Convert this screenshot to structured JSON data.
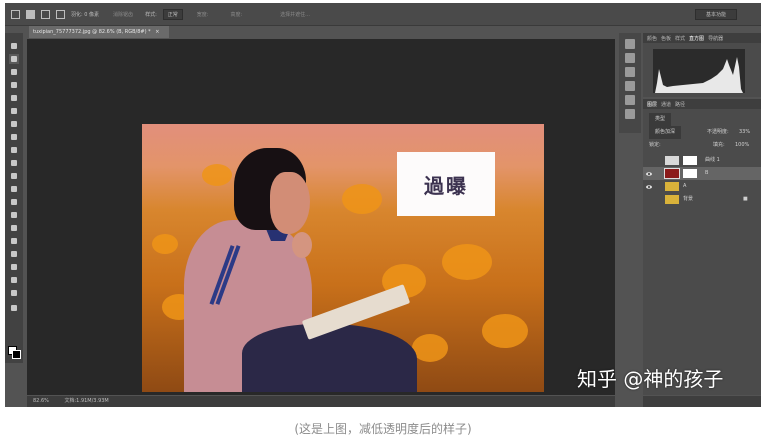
{
  "options_bar": {
    "feather_label": "羽化: 0 像素",
    "antialias_label": "消除锯齿",
    "style_label": "样式:",
    "style_value": "正常",
    "width_label": "宽度:",
    "height_label": "高度:",
    "refine_button": "选择并遮住...",
    "workspace_select": "基本功能"
  },
  "document": {
    "tab_label": "tuxipian_75777372.jpg @ 82.6% (B, RGB/8#) *",
    "tab_close": "×",
    "status_zoom": "82.6%",
    "status_doc": "文档:1.91M/3.93M"
  },
  "canvas": {
    "caption_text": "過曝",
    "watermark": "知乎 @神的孩子"
  },
  "histogram_panel": {
    "tabs": [
      "颜色",
      "色板",
      "样式",
      "直方图",
      "导航器"
    ],
    "active_tab": "直方图"
  },
  "layers_panel": {
    "tabs": [
      "图层",
      "通道",
      "路径"
    ],
    "active_tab": "图层",
    "filter_label": "类型",
    "blend_mode": "颜色加深",
    "opacity_label": "不透明度:",
    "opacity_value": "33%",
    "lock_label": "锁定:",
    "fill_label": "填充:",
    "fill_value": "100%",
    "layers": [
      {
        "name": "曲线 1",
        "visible": false,
        "selected": false,
        "thumb_color": "#ffffff"
      },
      {
        "name": "B",
        "visible": true,
        "selected": true,
        "thumb_color": "#8b1a1a"
      },
      {
        "name": "A",
        "visible": true,
        "selected": false,
        "thumb_color": "#d9b23a"
      },
      {
        "name": "背景",
        "visible": false,
        "selected": false,
        "thumb_color": "#d9b23a"
      }
    ]
  },
  "page_caption": "(这是上图，减低透明度后的样子)"
}
